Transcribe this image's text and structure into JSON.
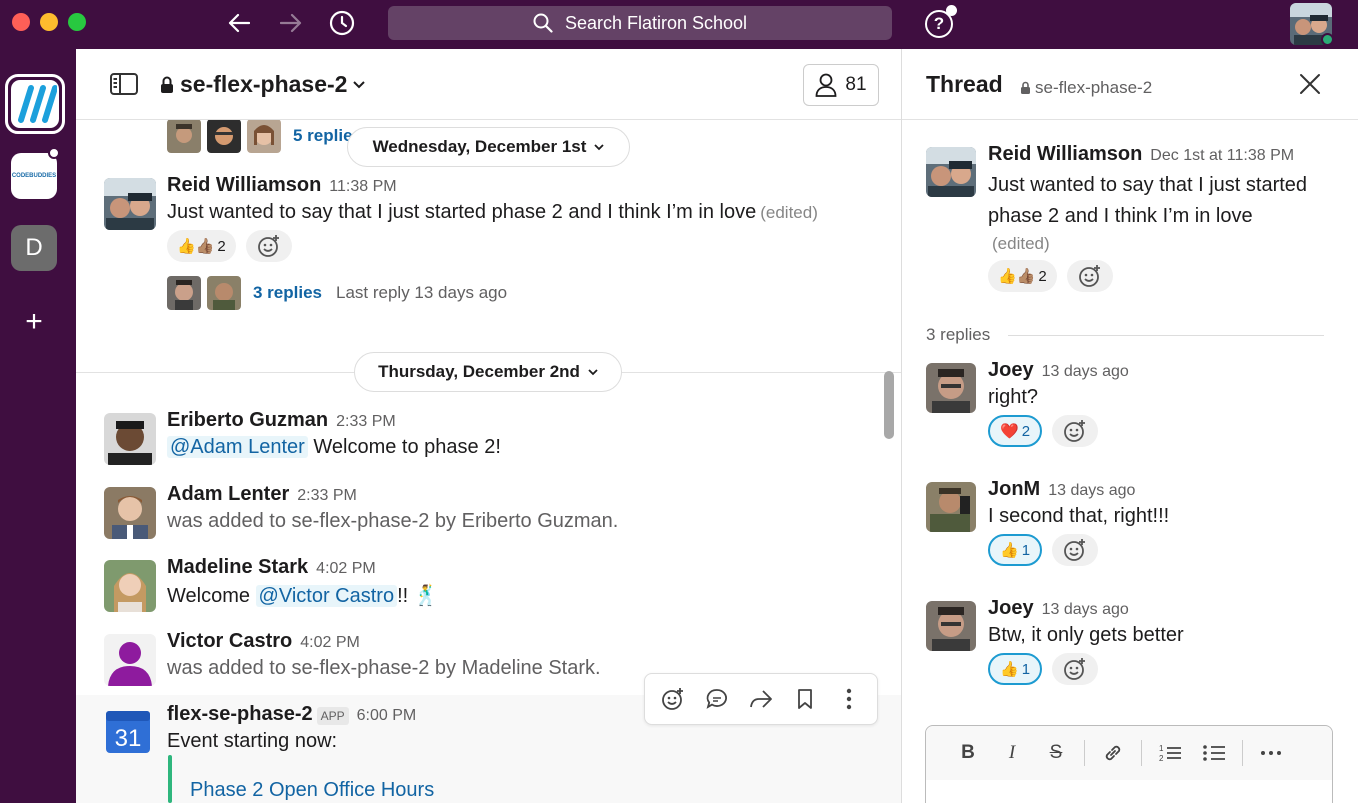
{
  "search": {
    "placeholder": "Search Flatiron School"
  },
  "workspaces": {
    "d_label": "D",
    "add_label": "+",
    "codebuddies_label": "CODEBUDDIES"
  },
  "channel": {
    "name": "se-flex-phase-2",
    "member_count": "81",
    "top_thread": {
      "replies": "5 replies"
    },
    "dates": [
      "Wednesday, December 1st",
      "Thursday, December 2nd"
    ],
    "messages": [
      {
        "author": "Reid Williamson",
        "time": "11:38 PM",
        "text": "Just wanted to say that I just started phase 2 and I think I’m in love",
        "edited": "(edited)",
        "reaction": {
          "emoji": "👍👍🏽",
          "count": "2"
        },
        "thread": {
          "replies": "3 replies",
          "last_reply": "Last reply 13 days ago"
        }
      },
      {
        "author": "Eriberto Guzman",
        "time": "2:33 PM",
        "mention": "@Adam Lenter",
        "text": " Welcome to phase 2!"
      },
      {
        "author": "Adam Lenter",
        "time": "2:33 PM",
        "text": "was added to se-flex-phase-2 by Eriberto Guzman."
      },
      {
        "author": "Madeline Stark",
        "time": "4:02 PM",
        "text_before": "Welcome ",
        "mention": "@Victor Castro",
        "text_after": "!! ",
        "emoji": "🕺"
      },
      {
        "author": "Victor Castro",
        "time": "4:02 PM",
        "text": "was added to se-flex-phase-2 by Madeline Stark."
      },
      {
        "author": "flex-se-phase-2",
        "app_badge": "APP",
        "time": "6:00 PM",
        "text": "Event starting now:",
        "event_link": "Phase 2 Open Office Hours",
        "calendar_day": "31"
      }
    ]
  },
  "thread": {
    "title": "Thread",
    "channel": "se-flex-phase-2",
    "parent": {
      "author": "Reid Williamson",
      "time": "Dec 1st at 11:38 PM",
      "text": "Just wanted to say that I just started phase 2 and I think I’m in love",
      "edited": "(edited)",
      "reaction": {
        "emoji": "👍👍🏽",
        "count": "2"
      }
    },
    "replies_label": "3 replies",
    "replies": [
      {
        "author": "Joey",
        "time": "13 days ago",
        "text": "right?",
        "reaction": {
          "emoji": "❤️",
          "count": "2"
        }
      },
      {
        "author": "JonM",
        "time": "13 days ago",
        "text": "I second that, right!!!",
        "reaction": {
          "emoji": "👍",
          "count": "1"
        }
      },
      {
        "author": "Joey",
        "time": "13 days ago",
        "text": "Btw, it only gets better",
        "reaction": {
          "emoji": "👍",
          "count": "1"
        }
      }
    ],
    "composer_tools": [
      "B",
      "I",
      "S",
      "link",
      "ordered-list",
      "bullet-list",
      "more"
    ]
  },
  "colors": {
    "aubergine": "#3f0e40",
    "link": "#1264a3",
    "accent": "#1d9bd1",
    "event_green": "#2eb67d"
  }
}
